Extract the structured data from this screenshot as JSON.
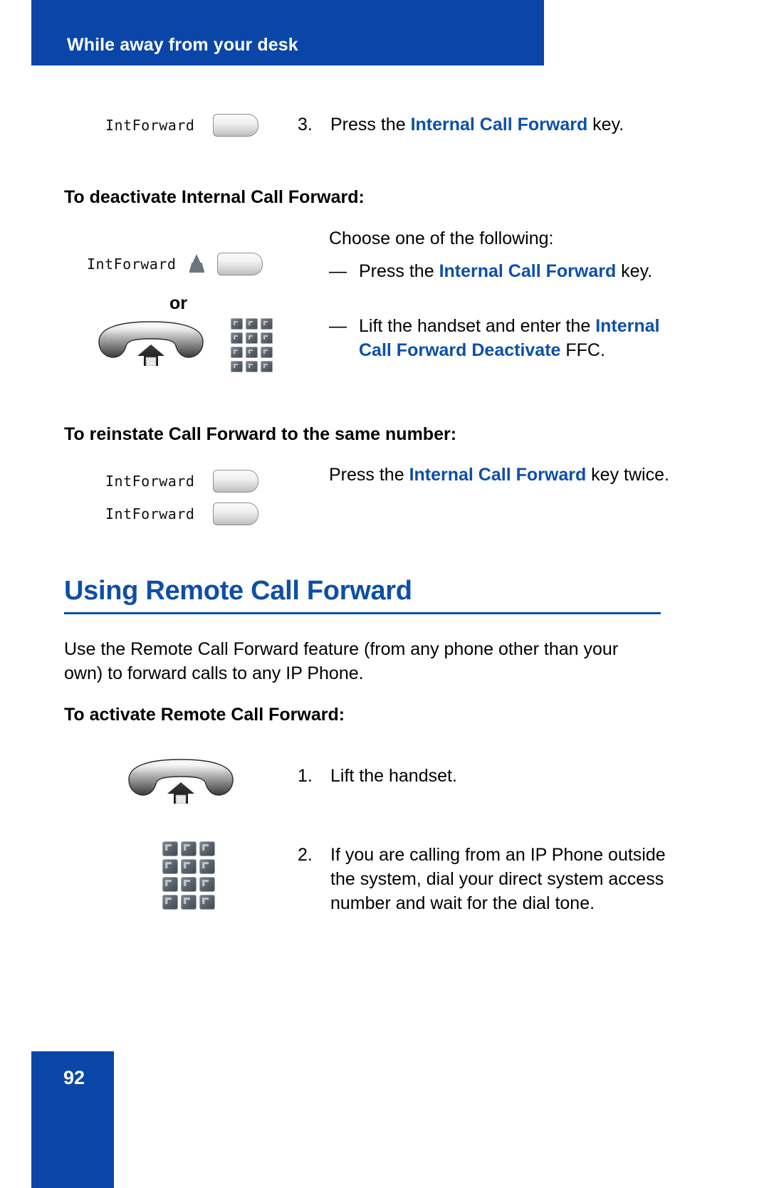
{
  "header": {
    "title": "While away from your desk"
  },
  "steps": {
    "step3": {
      "number": "3.",
      "text_before": "Press the ",
      "term": "Internal Call Forward",
      "text_after": " key.",
      "key_label": "IntForward"
    }
  },
  "sections": [
    {
      "heading": "To deactivate Internal Call Forward:",
      "intro": "Choose one of the following:",
      "key_label": "IntForward",
      "or_label": "or",
      "bullets": [
        {
          "mark": "—",
          "text_before": "Press the ",
          "term": "Internal Call Forward",
          "text_after": " key."
        },
        {
          "mark": "—",
          "text_before": "Lift the handset and enter the ",
          "term": "Internal Call Forward Deactivate",
          "text_after": " FFC."
        }
      ]
    },
    {
      "heading": "To reinstate Call Forward to the same number:",
      "key_label_1": "IntForward",
      "key_label_2": "IntForward",
      "text_before": "Press the ",
      "term": "Internal Call Forward",
      "text_after": " key twice."
    }
  ],
  "major_heading": "Using Remote Call Forward",
  "intro_paragraph": "Use the Remote Call Forward feature (from any phone other than your own) to forward calls to any IP Phone.",
  "activate_section": {
    "heading": "To activate Remote Call Forward:",
    "steps": [
      {
        "number": "1.",
        "text": "Lift the handset."
      },
      {
        "number": "2.",
        "text": "If you are calling from an IP Phone outside the system, dial your direct system access number and wait for the dial tone."
      }
    ]
  },
  "footer": {
    "page_number": "92"
  },
  "icons": {
    "feature_key": "feature-key-icon",
    "led": "led-indicator-icon",
    "handset": "handset-lift-icon",
    "keypad": "dial-keypad-icon"
  },
  "colors": {
    "brand_blue": "#0A46A8",
    "term_blue": "#0D4FA8",
    "heading_blue": "#0D4FA8"
  }
}
